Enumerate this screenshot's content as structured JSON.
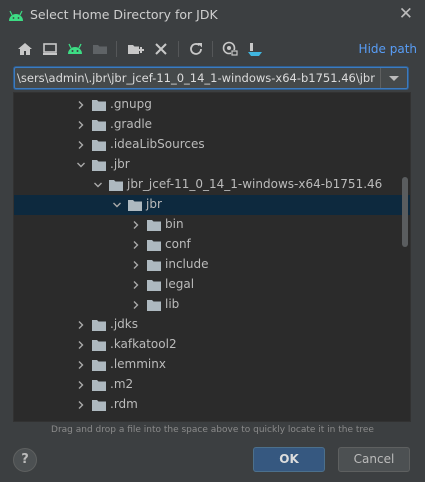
{
  "window": {
    "title": "Select Home Directory for JDK",
    "close_icon": "close-icon"
  },
  "toolbar": {
    "icons": [
      "home-icon",
      "desktop-icon",
      "android-icon",
      "project-folder-icon",
      "new-folder-icon",
      "delete-icon",
      "refresh-icon",
      "show-hidden-icon",
      "share-icon"
    ],
    "hide_path_label": "Hide path"
  },
  "path_field": {
    "value": "\\sers\\admin\\.jbr\\jbr_jcef-11_0_14_1-windows-x64-b1751.46\\jbr"
  },
  "tree": {
    "rows": [
      {
        "label": ".gnupg",
        "expanded": false,
        "selected": false
      },
      {
        "label": ".gradle",
        "expanded": false,
        "selected": false
      },
      {
        "label": ".ideaLibSources",
        "expanded": false,
        "selected": false
      },
      {
        "label": ".jbr",
        "expanded": true,
        "selected": false
      },
      {
        "label": "jbr_jcef-11_0_14_1-windows-x64-b1751.46",
        "expanded": true,
        "selected": false
      },
      {
        "label": "jbr",
        "expanded": true,
        "selected": true
      },
      {
        "label": "bin",
        "expanded": false,
        "selected": false
      },
      {
        "label": "conf",
        "expanded": false,
        "selected": false
      },
      {
        "label": "include",
        "expanded": false,
        "selected": false
      },
      {
        "label": "legal",
        "expanded": false,
        "selected": false
      },
      {
        "label": "lib",
        "expanded": false,
        "selected": false
      },
      {
        "label": ".jdks",
        "expanded": false,
        "selected": false
      },
      {
        "label": ".kafkatool2",
        "expanded": false,
        "selected": false
      },
      {
        "label": ".lemminx",
        "expanded": false,
        "selected": false
      },
      {
        "label": ".m2",
        "expanded": false,
        "selected": false
      },
      {
        "label": ".rdm",
        "expanded": false,
        "selected": false
      }
    ]
  },
  "hint_text": "Drag and drop a file into the space above to quickly locate it in the tree",
  "buttons": {
    "help": "?",
    "ok": "OK",
    "cancel": "Cancel"
  },
  "colors": {
    "background": "#3c3f41",
    "tree_background": "#2b2b2b",
    "selection": "#0d293e",
    "accent_link": "#589df6",
    "folder": "#aeb9c0",
    "android_green": "#3ddc84"
  }
}
